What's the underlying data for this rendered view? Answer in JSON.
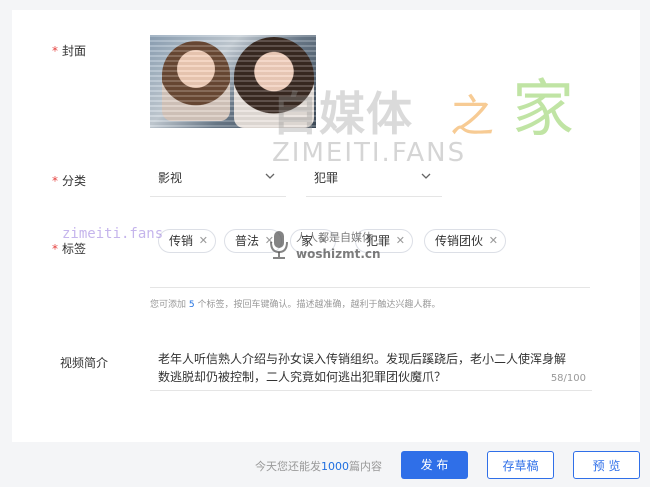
{
  "form": {
    "cover_label": "封面",
    "category_label": "分类",
    "tags_label": "标签",
    "description_label": "视频简介",
    "category_primary": "影视",
    "category_secondary": "犯罪",
    "tags": [
      "传销",
      "普法",
      "家",
      "犯罪",
      "传销团伙"
    ],
    "tag_hint_prefix": "您可添加",
    "tag_hint_count": "5",
    "tag_hint_suffix": "个标签，按回车键确认。描述越准确，越利于触达兴趣人群。",
    "description": "老年人听信熟人介绍与孙女误入传销组织。发现后蹊跷后，老小二人使浑身解数逃脱却仍被控制，二人究竟如何逃出犯罪团伙魔爪？",
    "description_count": "58/100"
  },
  "footer": {
    "quota_prefix": "今天您还能发",
    "quota_number": "1000",
    "quota_suffix": "篇内容",
    "publish_label": "发 布",
    "draft_label": "存草稿",
    "preview_label": "预 览"
  },
  "watermarks": {
    "brand_cn": "自媒体",
    "brand_zhi": "之",
    "brand_jia": "家",
    "brand_en": "ZIMEITI.FANS",
    "small_url": "zimeiti.fans",
    "woshi_cn": "人人都是自媒体",
    "woshi_url": "woshizmt.cn"
  },
  "colors": {
    "accent": "#2f6fe8",
    "required": "#e64340"
  },
  "icons": {
    "tag_remove": "close-icon",
    "dropdown": "chevron-down-icon"
  }
}
